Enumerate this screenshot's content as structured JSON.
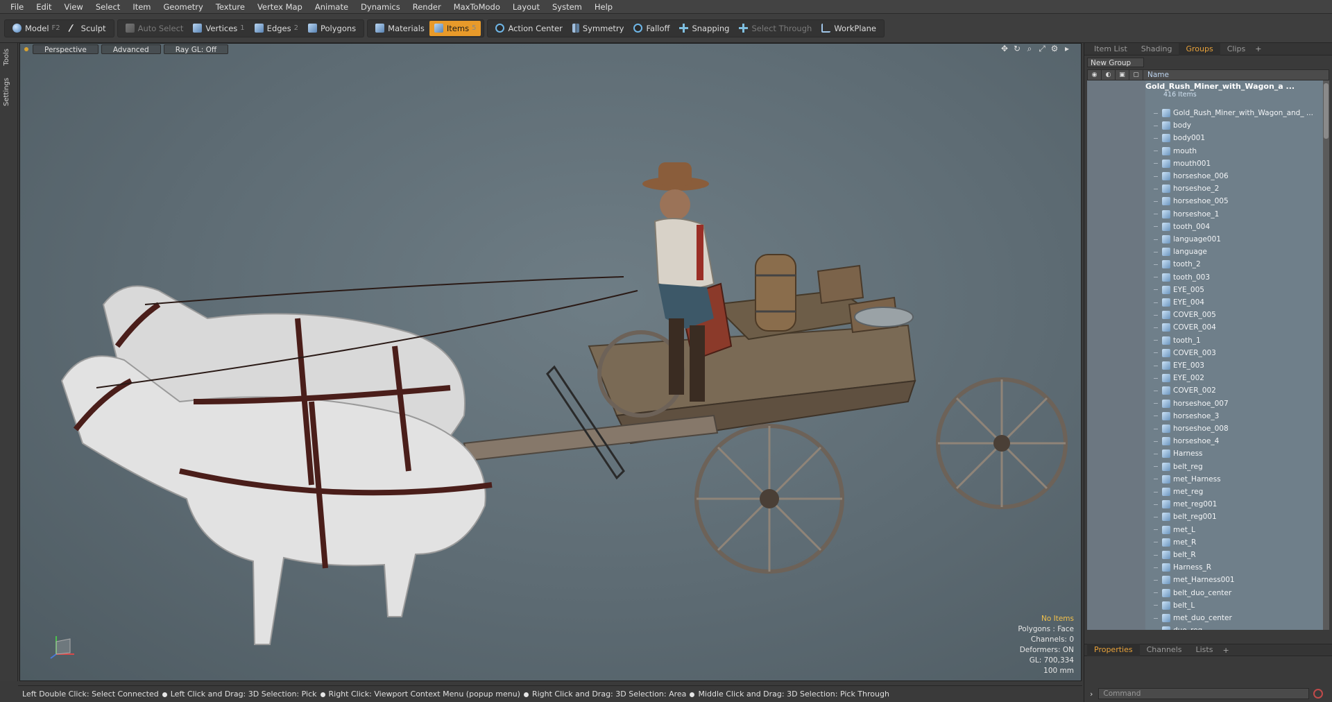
{
  "menubar": [
    "File",
    "Edit",
    "View",
    "Select",
    "Item",
    "Geometry",
    "Texture",
    "Vertex Map",
    "Animate",
    "Dynamics",
    "Render",
    "MaxToModo",
    "Layout",
    "System",
    "Help"
  ],
  "toolbar": {
    "model": "Model",
    "model_key": "F2",
    "sculpt": "Sculpt",
    "auto_select": "Auto Select",
    "vertices": "Vertices",
    "vertices_key": "1",
    "edges": "Edges",
    "edges_key": "2",
    "polygons": "Polygons",
    "materials": "Materials",
    "items": "Items",
    "items_key": "5",
    "action_center": "Action Center",
    "symmetry": "Symmetry",
    "falloff": "Falloff",
    "snapping": "Snapping",
    "select_through": "Select Through",
    "workplane": "WorkPlane"
  },
  "left_tabs": [
    "Tools",
    "Settings"
  ],
  "viewport": {
    "perspective": "Perspective",
    "advanced": "Advanced",
    "raygl": "Ray GL: Off",
    "hud": {
      "no_items": "No Items",
      "polygons": "Polygons : Face",
      "channels": "Channels: 0",
      "deformers": "Deformers: ON",
      "gl": "GL: 700,334",
      "scale": "100 mm"
    }
  },
  "statusbar": [
    "Left Double Click: Select Connected",
    "Left Click and Drag: 3D Selection: Pick",
    "Right Click: Viewport Context Menu (popup menu)",
    "Right Click and Drag: 3D Selection: Area",
    "Middle Click and Drag: 3D Selection: Pick Through"
  ],
  "rightpanel": {
    "tabs": [
      "Item List",
      "Shading",
      "Groups",
      "Clips"
    ],
    "active_tab": "Groups",
    "new_group": "New Group",
    "name_header": "Name",
    "root_name": "Gold_Rush_Miner_with_Wagon_a ...",
    "root_count": "416 Items",
    "items": [
      "Gold_Rush_Miner_with_Wagon_and_ ...",
      "body",
      "body001",
      "mouth",
      "mouth001",
      "horseshoe_006",
      "horseshoe_2",
      "horseshoe_005",
      "horseshoe_1",
      "tooth_004",
      "language001",
      "language",
      "tooth_2",
      "tooth_003",
      "EYE_005",
      "EYE_004",
      "COVER_005",
      "COVER_004",
      "tooth_1",
      "COVER_003",
      "EYE_003",
      "EYE_002",
      "COVER_002",
      "horseshoe_007",
      "horseshoe_3",
      "horseshoe_008",
      "horseshoe_4",
      "Harness",
      "belt_reg",
      "met_Harness",
      "met_reg",
      "met_reg001",
      "belt_reg001",
      "met_L",
      "met_R",
      "belt_R",
      "Harness_R",
      "met_Harness001",
      "belt_duo_center",
      "belt_L",
      "met_duo_center",
      "duo_reg"
    ],
    "bottom_tabs": [
      "Properties",
      "Channels",
      "Lists"
    ],
    "command_placeholder": "Command"
  },
  "colors": {
    "accent": "#e89a2a",
    "viewport_bg": "#5d6b73",
    "tree_bg": "#6f7f8a"
  }
}
